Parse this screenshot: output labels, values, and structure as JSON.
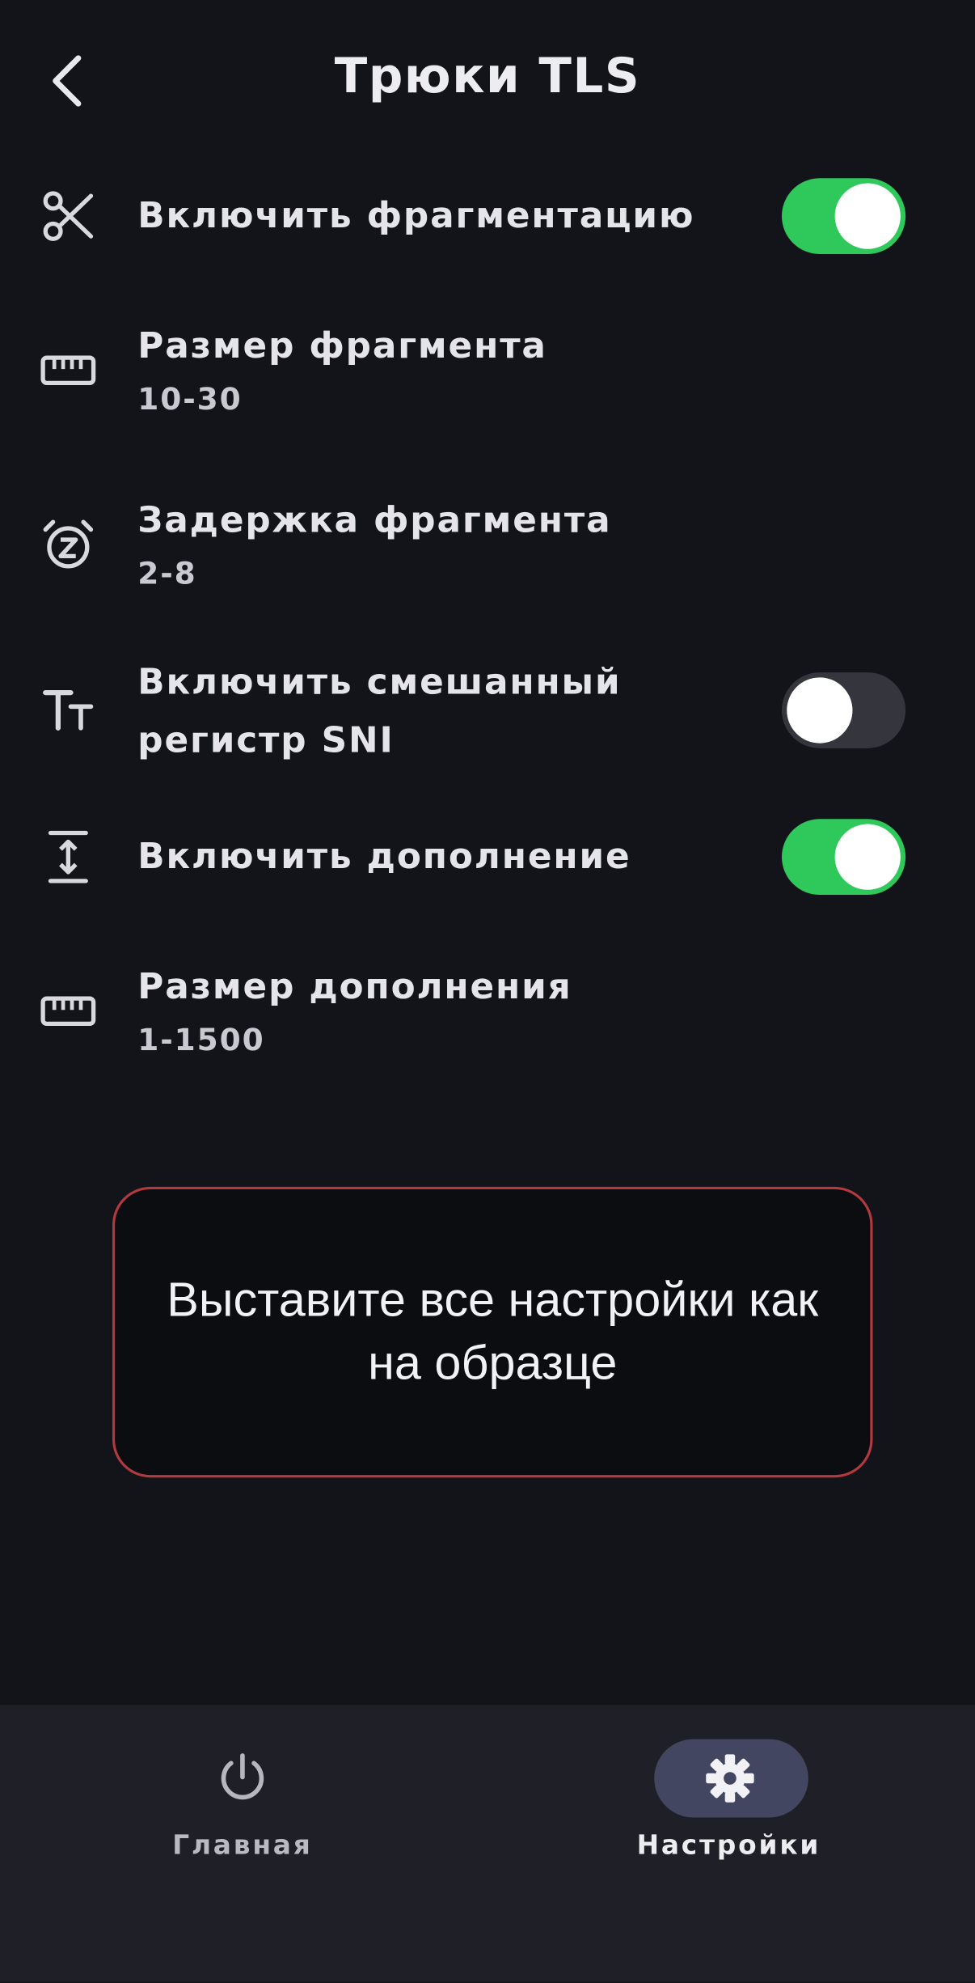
{
  "header": {
    "title": "Трюки TLS",
    "back_icon": "chevron-left-icon"
  },
  "settings": [
    {
      "label": "Включить фрагментацию",
      "icon": "scissors-icon",
      "toggle": true,
      "value": null
    },
    {
      "label": "Размер фрагмента",
      "icon": "ruler-icon",
      "toggle": null,
      "value": "10-30"
    },
    {
      "label": "Задержка фрагмента",
      "icon": "snooze-alarm-icon",
      "toggle": null,
      "value": "2-8"
    },
    {
      "label": "Включить смешанный регистр SNI",
      "icon": "text-case-icon",
      "toggle": false,
      "value": null
    },
    {
      "label": "Включить дополнение",
      "icon": "vertical-expand-icon",
      "toggle": true,
      "value": null
    },
    {
      "label": "Размер дополнения",
      "icon": "ruler-icon",
      "toggle": null,
      "value": "1-1500"
    }
  ],
  "notice": {
    "text": "Выставите все настройки как на образце"
  },
  "nav": [
    {
      "label": "Главная",
      "icon": "power-icon",
      "active": false
    },
    {
      "label": "Настройки",
      "icon": "gear-icon",
      "active": true
    }
  ],
  "colors": {
    "background": "#13141a",
    "toggle_on": "#2fc85a",
    "toggle_off": "#35363d",
    "notice_border": "#b23a3e",
    "nav_bar": "#1f2027",
    "nav_active_pill": "#434660"
  }
}
